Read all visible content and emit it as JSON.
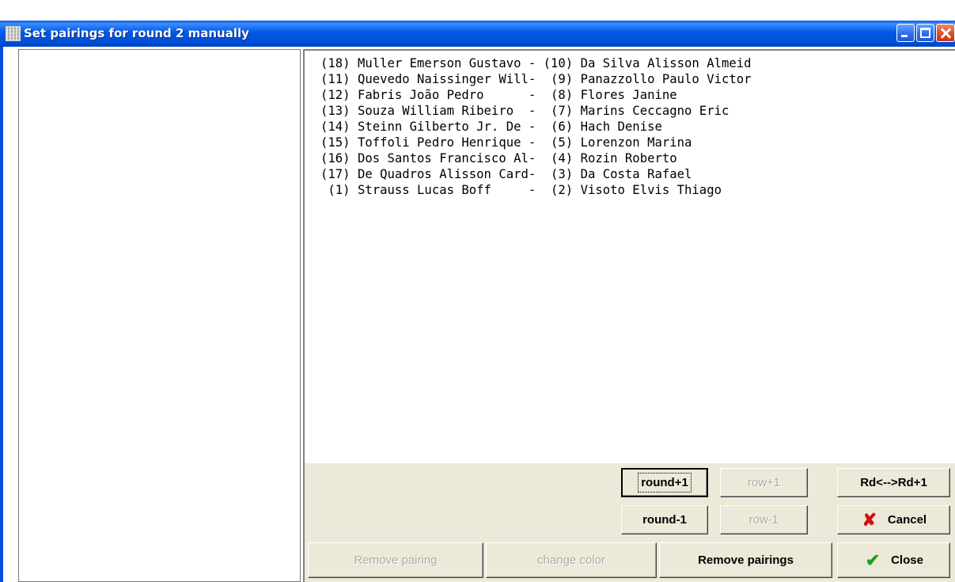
{
  "window": {
    "title": "Set pairings for round 2 manually"
  },
  "icons": {
    "app": "checkered-app-icon",
    "cancel": "red-x-icon",
    "close": "green-checkmark-icon"
  },
  "colors": {
    "titlebar": "#0058e8",
    "panel": "#ece9d8",
    "disabled_text": "#acaca4",
    "cancel_icon": "#d01010",
    "close_icon": "#1aa21a"
  },
  "pairings": [
    "(18) Muller Emerson Gustavo - (10) Da Silva Alisson Almeid",
    "(11) Quevedo Naissinger Will-  (9) Panazzollo Paulo Victor",
    "(12) Fabris João Pedro      -  (8) Flores Janine",
    "(13) Souza William Ribeiro  -  (7) Marins Ceccagno Eric",
    "(14) Steinn Gilberto Jr. De -  (6) Hach Denise",
    "(15) Toffoli Pedro Henrique -  (5) Lorenzon Marina",
    "(16) Dos Santos Francisco Al-  (4) Rozin Roberto",
    "(17) De Quadros Alisson Card-  (3) Da Costa Rafael",
    " (1) Strauss Lucas Boff     -  (2) Visoto Elvis Thiago"
  ],
  "buttons": {
    "round_plus": "round+1",
    "row_plus": "row+1",
    "rd_swap": "Rd<-->Rd+1",
    "round_minus": "round-1",
    "row_minus": "row-1",
    "cancel": "Cancel",
    "remove_pairing": "Remove pairing",
    "change_color": "change color",
    "remove_pairings": "Remove pairings",
    "close": "Close"
  }
}
